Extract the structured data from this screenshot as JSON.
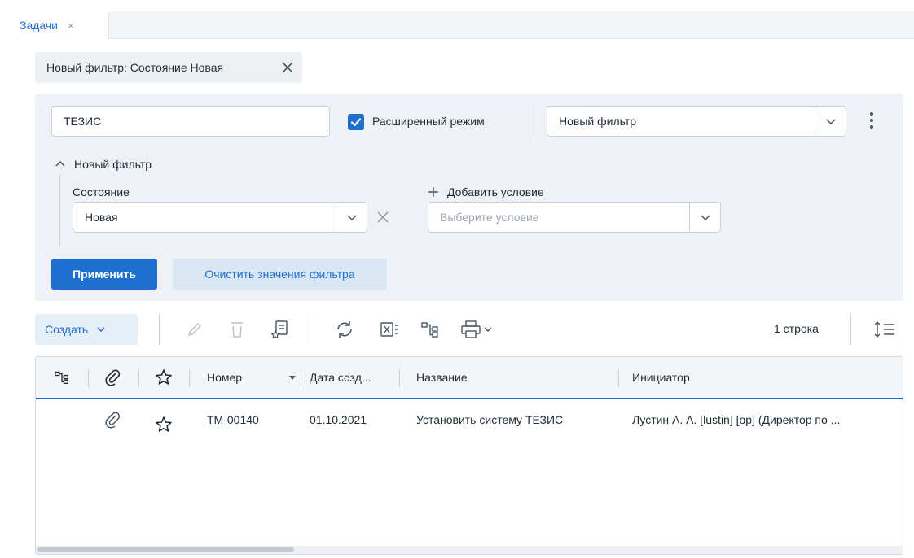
{
  "tabs": [
    {
      "label": "Задачи",
      "close": "×"
    }
  ],
  "applied_filter": {
    "label": "Новый фильтр: Состояние Новая"
  },
  "filter_panel": {
    "search_value": "ТЕЗИС",
    "advanced_mode_label": "Расширенный режим",
    "advanced_mode_checked": true,
    "filter_select_value": "Новый фильтр",
    "group_title": "Новый фильтр",
    "condition_field_label": "Состояние",
    "condition_value": "Новая",
    "add_condition_label": "Добавить условие",
    "add_condition_placeholder": "Выберите условие",
    "apply_label": "Применить",
    "clear_label": "Очистить значения фильтра"
  },
  "toolbar": {
    "create_label": "Создать",
    "rows_count": "1 строка"
  },
  "table": {
    "columns": [
      "Номер",
      "Дата созд...",
      "Название",
      "Инициатор"
    ],
    "rows": [
      {
        "number": "ТМ-00140",
        "date": "01.10.2021",
        "name": "Установить систему ТЕЗИС",
        "initiator": "Лустин А. А. [lustin] [op] (Директор по ..."
      }
    ]
  },
  "colors": {
    "accent": "#1f6fcf",
    "panel_bg": "#eef1f5",
    "secondary_btn_bg": "#d9e7f5"
  }
}
